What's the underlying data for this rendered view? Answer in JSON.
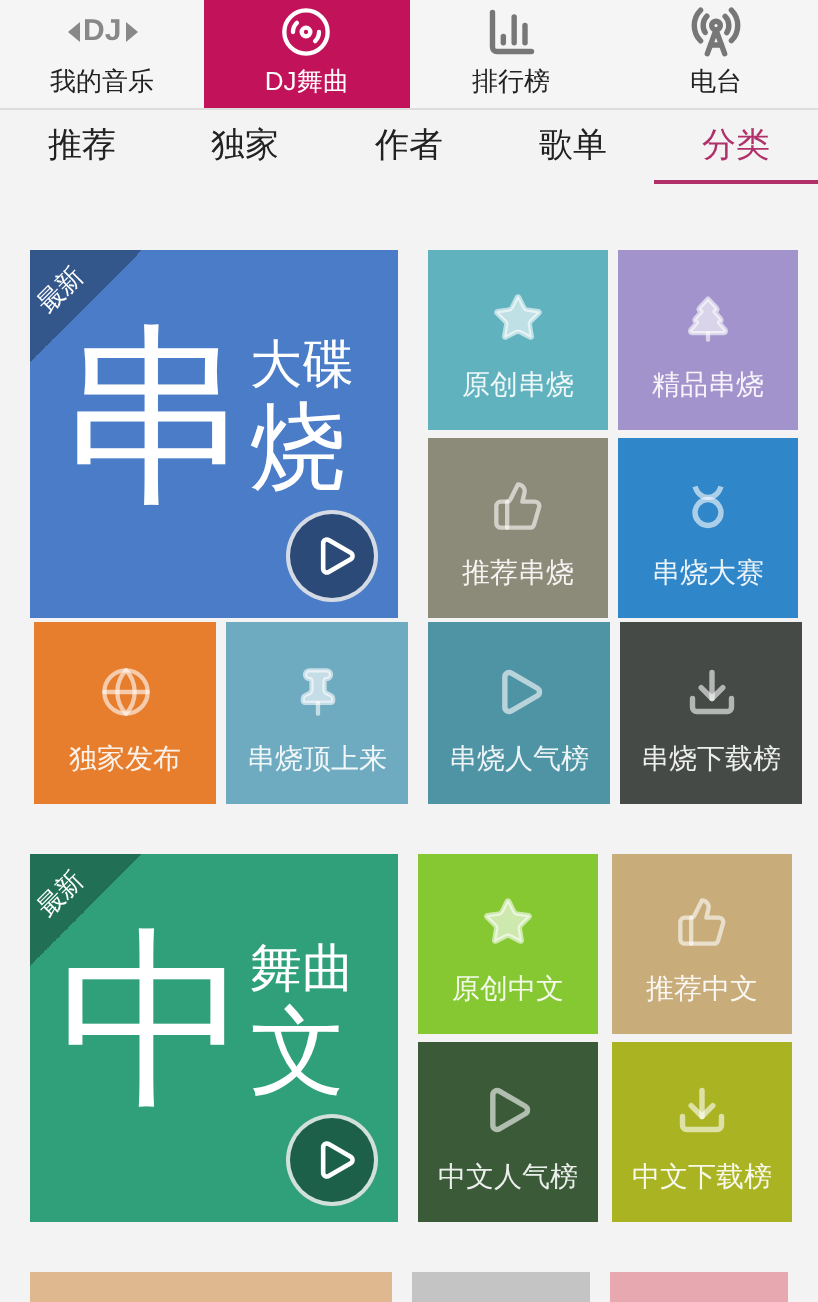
{
  "nav": [
    {
      "label": "我的音乐",
      "kind": "dj",
      "icon_text": "DJ",
      "selected": false
    },
    {
      "label": "DJ舞曲",
      "kind": "disc",
      "selected": true
    },
    {
      "label": "排行榜",
      "kind": "bars",
      "selected": false
    },
    {
      "label": "电台",
      "kind": "antenna",
      "selected": false
    }
  ],
  "tabs": [
    {
      "label": "推荐",
      "selected": false
    },
    {
      "label": "独家",
      "selected": false
    },
    {
      "label": "作者",
      "selected": false
    },
    {
      "label": "歌单",
      "selected": false
    },
    {
      "label": "分类",
      "selected": true
    }
  ],
  "sections": [
    {
      "feature": {
        "badge": "最新",
        "main": "串",
        "top": "大碟",
        "side": "烧",
        "color": "#4a7cc7"
      },
      "grid": [
        {
          "label": "原创串烧",
          "kind": "star",
          "color": "#5fb2be"
        },
        {
          "label": "精品串烧",
          "kind": "tree",
          "color": "#a393cc"
        },
        {
          "label": "推荐串烧",
          "kind": "thumb",
          "color": "#8c8a78"
        },
        {
          "label": "串烧大赛",
          "kind": "ring",
          "color": "#2f86c8"
        }
      ],
      "row": [
        {
          "label": "独家发布",
          "kind": "globe",
          "color": "#e67e2e"
        },
        {
          "label": "串烧顶上来",
          "kind": "pin",
          "color": "#6eaac0"
        },
        {
          "label": "串烧人气榜",
          "kind": "play",
          "color": "#4f94a4"
        },
        {
          "label": "串烧下载榜",
          "kind": "download",
          "color": "#454a46"
        }
      ]
    },
    {
      "feature": {
        "badge": "最新",
        "main": "中",
        "top": "舞曲",
        "side": "文",
        "color": "#2fa07a"
      },
      "grid": [
        {
          "label": "原创中文",
          "kind": "star",
          "color": "#86c832"
        },
        {
          "label": "推荐中文",
          "kind": "thumb",
          "color": "#c8ac7a"
        },
        {
          "label": "中文人气榜",
          "kind": "play",
          "color": "#3a5a38"
        },
        {
          "label": "中文下载榜",
          "kind": "download",
          "color": "#aab422"
        }
      ]
    }
  ],
  "next_tiles": [
    {
      "color": "#e0b890"
    },
    {
      "color": "#c4c4c4"
    },
    {
      "color": "#e8a8b0"
    }
  ]
}
